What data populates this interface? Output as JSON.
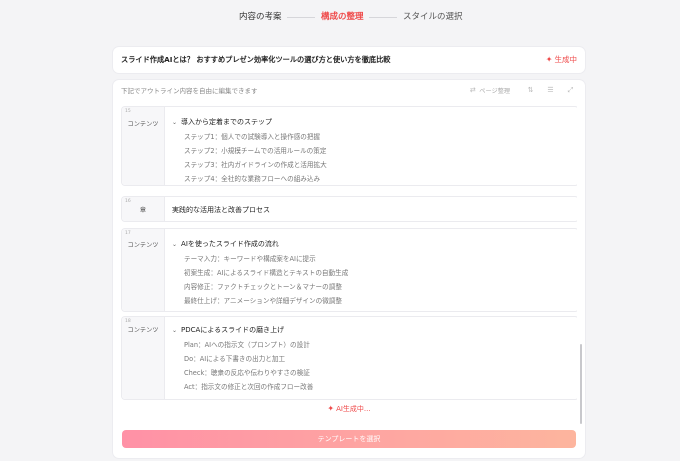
{
  "stepper": {
    "steps": [
      {
        "label": "内容の考案"
      },
      {
        "label": "構成の整理"
      },
      {
        "label": "スタイルの選択"
      }
    ]
  },
  "title_card": {
    "title": "スライド作成AIとは？ おすすめプレゼン効率化ツールの選び方と使い方を徹底比較",
    "status": "生成中"
  },
  "panel": {
    "hint": "下記でアウトライン内容を自由に編集できます",
    "page_toggle": "ページ整理"
  },
  "sections": [
    {
      "num": "15",
      "type": "コンテンツ",
      "heading": "導入から定着までのステップ",
      "items": [
        "ステップ1：個人での試験導入と操作感の把握",
        "ステップ2：小規模チームでの活用ルールの策定",
        "ステップ3：社内ガイドラインの作成と活用拡大",
        "ステップ4：全社的な業務フローへの組み込み"
      ]
    },
    {
      "num": "16",
      "type": "章",
      "heading": "実践的な活用法と改善プロセス",
      "items": []
    },
    {
      "num": "17",
      "type": "コンテンツ",
      "heading": "AIを使ったスライド作成の流れ",
      "items": [
        "テーマ入力：キーワードや構成案をAIに提示",
        "初案生成：AIによるスライド構造とテキストの自動生成",
        "内容修正：ファクトチェックとトーン＆マナーの調整",
        "最終仕上げ：アニメーションや詳細デザインの微調整"
      ]
    },
    {
      "num": "18",
      "type": "コンテンツ",
      "heading": "PDCAによるスライドの磨き上げ",
      "items": [
        "Plan：AIへの指示文（プロンプト）の設計",
        "Do：AIによる下書きの出力と加工",
        "Check：聴衆の反応や伝わりやすさの検証",
        "Act：指示文の修正と次回の作成フロー改善"
      ]
    }
  ],
  "ai_status": "AI生成中...",
  "cta": "テンプレートを選択",
  "colors": {
    "accent": "#ef4a4a",
    "cta_start": "#ff91a6",
    "cta_end": "#fdb59e"
  }
}
